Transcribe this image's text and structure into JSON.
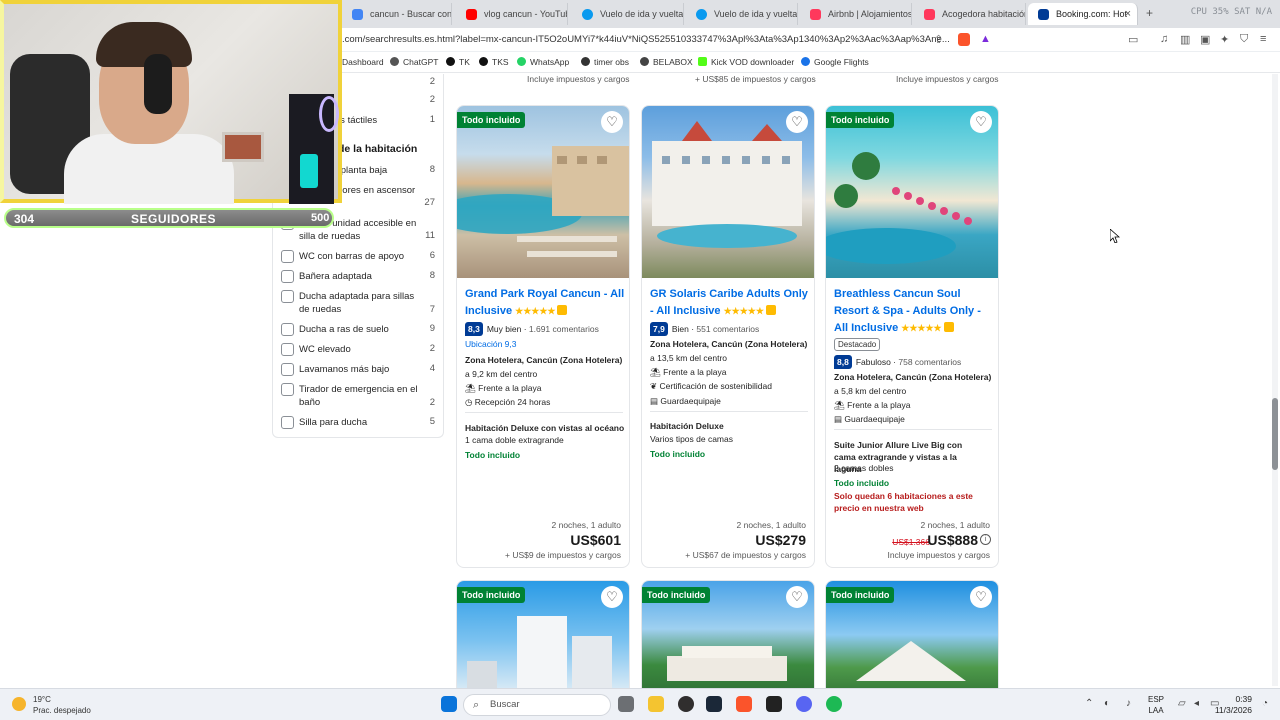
{
  "tabs": [
    {
      "label": "cancun - Buscar con G",
      "color": "#4285f4"
    },
    {
      "label": "vlog cancun - YouTube",
      "color": "#ff0000"
    },
    {
      "label": "Vuelo de ida y vuelta a",
      "color": "#0a9aef"
    },
    {
      "label": "Vuelo de ida y vuelta a",
      "color": "#0a9aef"
    },
    {
      "label": "Airbnb | Alojamientos",
      "color": "#ff385c"
    },
    {
      "label": "Acogedora habitación",
      "color": "#ff385c"
    },
    {
      "label": "Booking.com: Hot",
      "color": "#003b95"
    }
  ],
  "tab_extra": "CPU 35%  SAT N/A",
  "url": ".com/searchresults.es.html?label=mx-cancun-IT5O2oUMYi7*k44iuV*NiQS525510333747%3Apl%3Ata%3Ap1340%3Ap2%3Aac%3Aap%3Ane...",
  "bookmarks": [
    "Dashboard",
    "ChatGPT",
    "TK",
    "TKS",
    "WhatsApp",
    "timer obs",
    "BELABOX",
    "Kick VOD downloader",
    "Google Flights"
  ],
  "overlay": {
    "followers": "304",
    "label": "SEGUIDORES",
    "goal": "500"
  },
  "sidebar": {
    "group_title": "de la habitación",
    "top_rows": [
      {
        "label": "",
        "count": "2"
      },
      {
        "label": "al: braille",
        "count": "2"
      },
      {
        "label": "al: carteles táctiles",
        "count": "1"
      }
    ],
    "rows": [
      {
        "label": "dad en la planta baja",
        "count": "8"
      },
      {
        "label": "sos superiores en ascensor",
        "count": "27"
      },
      {
        "label": "Toda la unidad accesible en silla de ruedas",
        "count": "11"
      },
      {
        "label": "WC con barras de apoyo",
        "count": "6"
      },
      {
        "label": "Bañera adaptada",
        "count": "8"
      },
      {
        "label": "Ducha adaptada para sillas de ruedas",
        "count": "7"
      },
      {
        "label": "Ducha a ras de suelo",
        "count": "9"
      },
      {
        "label": "WC elevado",
        "count": "2"
      },
      {
        "label": "Lavamanos más bajo",
        "count": "4"
      },
      {
        "label": "Tirador de emergencia en el baño",
        "count": "2"
      },
      {
        "label": "Silla para ducha",
        "count": "5"
      }
    ]
  },
  "top_partial": [
    "Incluye impuestos y cargos",
    "+ US$85 de impuestos y cargos",
    "Incluye impuestos y cargos"
  ],
  "cards": [
    {
      "badge": "Todo incluido",
      "title": "Grand Park Royal Cancun - All Inclusive",
      "stars": "★★★★★",
      "score": "8,3",
      "score_word": "Muy bien",
      "reviews": "1.691 comentarios",
      "location_score": "Ubicación 9,3",
      "zone": "Zona Hotelera, Cancún (Zona Hotelera)",
      "distance": "a 9,2 km del centro",
      "feature1": "Frente a la playa",
      "feature2": "Recepción 24 horas",
      "room": "Habitación Deluxe con vistas al océano",
      "beds": "1 cama doble extragrande",
      "plan": "Todo incluido",
      "nights": "2 noches, 1 adulto",
      "price": "US$601",
      "taxes": "+ US$9 de impuestos y cargos"
    },
    {
      "badge": "",
      "title": "GR Solaris Caribe Adults Only - All Inclusive",
      "stars": "★★★★★",
      "score": "7,9",
      "score_word": "Bien",
      "reviews": "551 comentarios",
      "zone": "Zona Hotelera, Cancún (Zona Hotelera)",
      "distance": "a 13,5 km del centro",
      "feature1": "Frente a la playa",
      "feature2": "Certificación de sostenibilidad",
      "feature3": "Guardaequipaje",
      "room": "Habitación Deluxe",
      "beds": "Varios tipos de camas",
      "plan": "Todo incluido",
      "nights": "2 noches, 1 adulto",
      "price": "US$279",
      "taxes": "+ US$67 de impuestos y cargos"
    },
    {
      "badge": "Todo incluido",
      "title": "Breathless Cancun Soul Resort & Spa - Adults Only - All Inclusive",
      "stars": "★★★★★",
      "featured": "Destacado",
      "score": "8,8",
      "score_word": "Fabuloso",
      "reviews": "758 comentarios",
      "zone": "Zona Hotelera, Cancún (Zona Hotelera)",
      "distance": "a 5,8 km del centro",
      "feature1": "Frente a la playa",
      "feature2": "Guardaequipaje",
      "room": "Suite Junior Allure Live Big con cama extragrande y vistas a la laguna",
      "beds": "2 camas dobles",
      "plan": "Todo incluido",
      "scarcity": "Solo quedan 6 habitaciones a este precio en nuestra web",
      "nights": "2 noches, 1 adulto",
      "old_price": "US$1.366",
      "price": "US$888",
      "taxes": "Incluye impuestos y cargos"
    }
  ],
  "bottom_badges": [
    "Todo incluido",
    "Todo incluido",
    "Todo incluido"
  ],
  "taskbar": {
    "temp": "19°C",
    "weather": "Prac. despejado",
    "search": "Buscar",
    "lang1": "ESP",
    "lang2": "LAA",
    "time": "0:39",
    "date": "11/3/2026"
  }
}
